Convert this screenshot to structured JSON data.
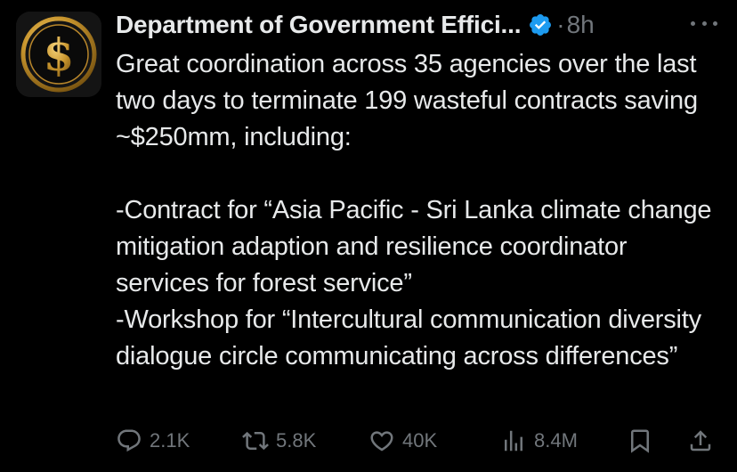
{
  "tweet": {
    "display_name": "Department of Government Effici...",
    "separator": "·",
    "time": "8h",
    "text": "Great coordination across 35 agencies over the last two days to terminate 199 wasteful contracts saving ~$250mm, including:\n\n-Contract for “Asia Pacific - Sri Lanka climate change mitigation adaption and resilience coordinator services for forest service”\n-Workshop for “Intercultural communication diversity dialogue circle communicating across differences”",
    "avatar_icon": "dollar-coin-icon",
    "verified_icon": "verified-badge-icon"
  },
  "actions": {
    "reply_count": "2.1K",
    "repost_count": "5.8K",
    "like_count": "40K",
    "views_count": "8.4M"
  },
  "colors": {
    "background": "#000000",
    "text": "#e7e9ea",
    "secondary": "#71767b",
    "verified": "#1d9bf0",
    "avatar_gold": "#d4a23a"
  }
}
